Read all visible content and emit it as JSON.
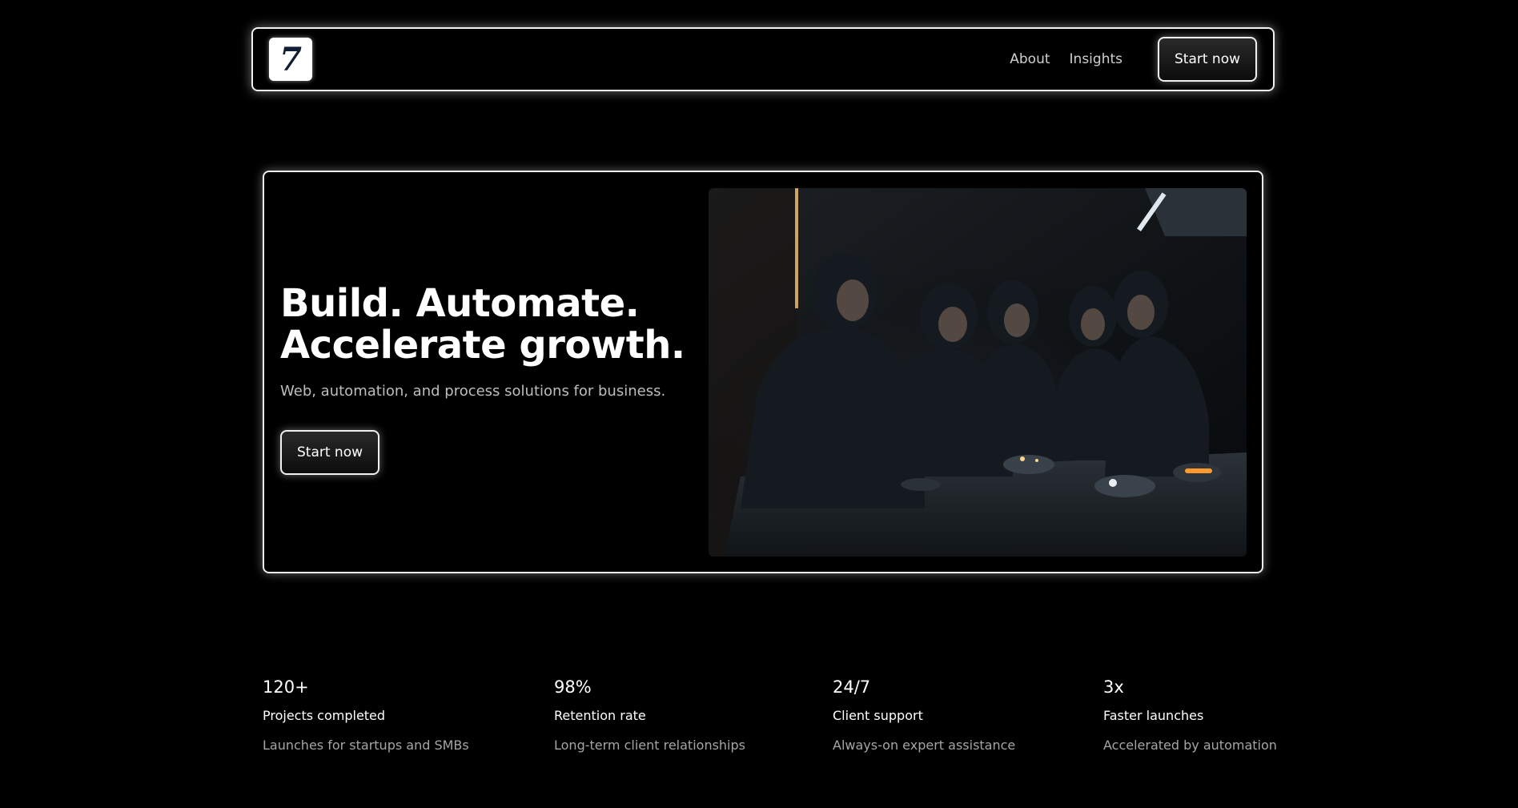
{
  "header": {
    "logo_glyph": "7",
    "nav": [
      {
        "label": "About"
      },
      {
        "label": "Insights"
      }
    ],
    "cta_label": "Start now"
  },
  "hero": {
    "title_line1": "Build. Automate.",
    "title_line2": "Accelerate growth.",
    "subtitle": "Web, automation, and process solutions for business.",
    "cta_label": "Start now",
    "image_alt": "Team of five people in dark clothing gathered around a table examining small glowing devices"
  },
  "stats": [
    {
      "value": "120+",
      "label": "Projects completed",
      "desc": "Launches for startups and SMBs"
    },
    {
      "value": "98%",
      "label": "Retention rate",
      "desc": "Long-term client relationships"
    },
    {
      "value": "24/7",
      "label": "Client support",
      "desc": "Always-on expert assistance"
    },
    {
      "value": "3x",
      "label": "Faster launches",
      "desc": "Accelerated by automation"
    }
  ],
  "colors": {
    "background": "#000000",
    "border": "#f0f0f0",
    "logo_text": "#0f1e33",
    "muted_text": "#a5a5a5"
  }
}
